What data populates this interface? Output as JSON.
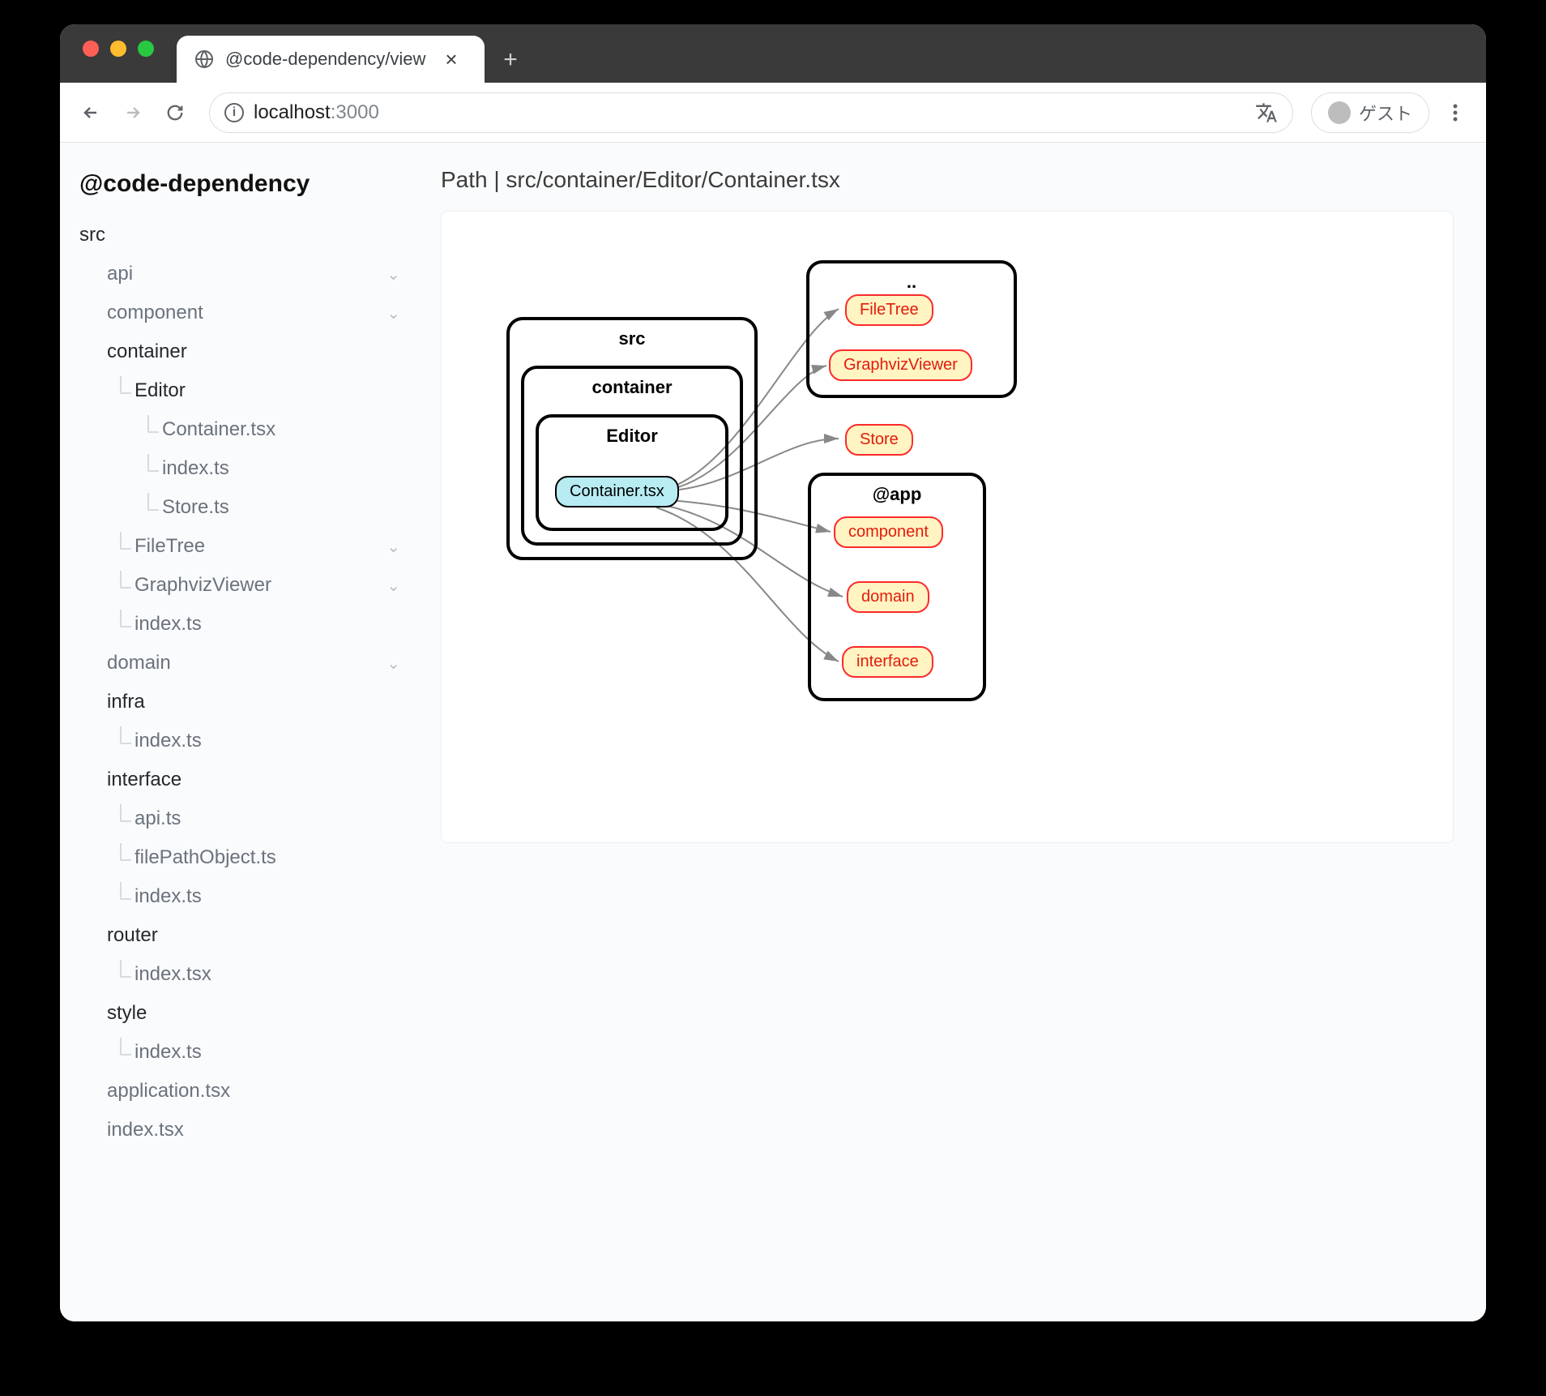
{
  "browser": {
    "tab_title": "@code-dependency/view",
    "url_host": "localhost",
    "url_port": ":3000",
    "guest_label": "ゲスト"
  },
  "sidebar": {
    "brand": "@code-dependency",
    "tree": {
      "src": "src",
      "api": "api",
      "component": "component",
      "container": "container",
      "editor": "Editor",
      "container_tsx": "Container.tsx",
      "editor_index_ts": "index.ts",
      "store_ts": "Store.ts",
      "filetree": "FileTree",
      "graphviz": "GraphvizViewer",
      "container_index_ts": "index.ts",
      "domain": "domain",
      "infra": "infra",
      "infra_index_ts": "index.ts",
      "interface": "interface",
      "api_ts": "api.ts",
      "filepathobject_ts": "filePathObject.ts",
      "interface_index_ts": "index.ts",
      "router": "router",
      "router_index_tsx": "index.tsx",
      "style": "style",
      "style_index_ts": "index.ts",
      "application_tsx": "application.tsx",
      "index_tsx": "index.tsx"
    }
  },
  "main": {
    "path_label": "Path | src/container/Editor/Container.tsx"
  },
  "graph": {
    "clusters": {
      "src": "src",
      "container": "container",
      "editor": "Editor",
      "dotdot": "..",
      "app": "@app"
    },
    "nodes": {
      "container_tsx": "Container.tsx",
      "filetree": "FileTree",
      "graphvizviewer": "GraphvizViewer",
      "store": "Store",
      "component": "component",
      "domain": "domain",
      "interface": "interface"
    }
  }
}
